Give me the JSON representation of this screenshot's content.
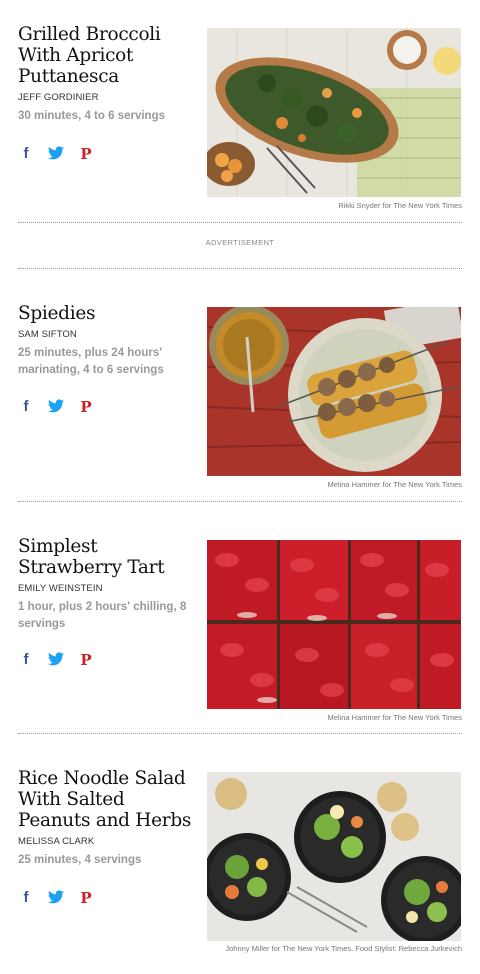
{
  "recipes": [
    {
      "title": "Grilled Broccoli With Apricot Puttanesca",
      "author": "JEFF GORDINIER",
      "time": "30 minutes, 4 to 6 servings",
      "credit": "Rikki Snyder for The New York Times"
    },
    {
      "title": "Spiedies",
      "author": "SAM SIFTON",
      "time": "25 minutes, plus 24 hours' marinating, 4 to 6 servings",
      "credit": "Melina Hammer for The New York Times"
    },
    {
      "title": "Simplest Strawberry Tart",
      "author": "EMILY WEINSTEIN",
      "time": "1 hour, plus 2 hours' chilling, 8 servings",
      "credit": "Melina Hammer for The New York Times"
    },
    {
      "title": "Rice Noodle Salad With Salted Peanuts and Herbs",
      "author": "MELISSA CLARK",
      "time": "25 minutes, 4 servings",
      "credit": "Johnny Miller for The New York Times. Food Stylist: Rebecca Jurkevich"
    }
  ],
  "advertisement": "ADVERTISEMENT",
  "social": {
    "facebook": "f",
    "pinterest": "P"
  },
  "colors": {
    "facebook": "#3b5998",
    "twitter": "#1da1f2",
    "pinterest": "#cb2027"
  },
  "icons": [
    "facebook-icon",
    "twitter-icon",
    "pinterest-icon"
  ]
}
